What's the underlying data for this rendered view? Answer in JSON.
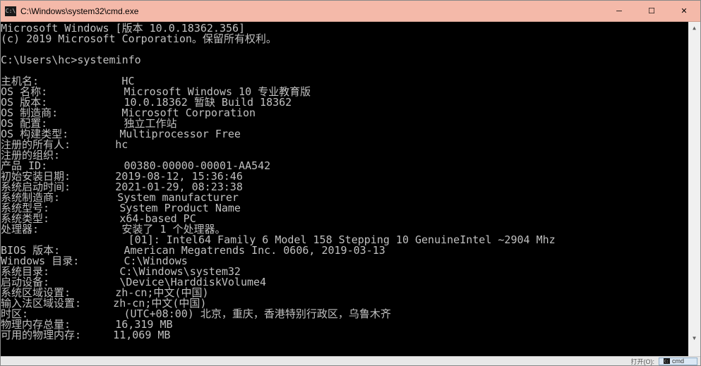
{
  "titlebar": {
    "icon_label": "C:\\",
    "title": "C:\\Windows\\system32\\cmd.exe",
    "minimize": "─",
    "maximize": "☐",
    "close": "✕"
  },
  "terminal": {
    "header1": "Microsoft Windows [版本 10.0.18362.356]",
    "header2": "(c) 2019 Microsoft Corporation。保留所有权利。",
    "prompt": "C:\\Users\\hc>",
    "command": "systeminfo",
    "rows": [
      {
        "label": "主机名:",
        "value": "HC"
      },
      {
        "label": "OS 名称:",
        "value": "Microsoft Windows 10 专业教育版"
      },
      {
        "label": "OS 版本:",
        "value": "10.0.18362 暂缺 Build 18362"
      },
      {
        "label": "OS 制造商:",
        "value": "Microsoft Corporation"
      },
      {
        "label": "OS 配置:",
        "value": "独立工作站"
      },
      {
        "label": "OS 构建类型:",
        "value": "Multiprocessor Free"
      },
      {
        "label": "注册的所有人:",
        "value": "hc"
      },
      {
        "label": "注册的组织:",
        "value": ""
      },
      {
        "label": "产品 ID:",
        "value": "00380-00000-00001-AA542"
      },
      {
        "label": "初始安装日期:",
        "value": "2019-08-12, 15:36:46"
      },
      {
        "label": "系统启动时间:",
        "value": "2021-01-29, 08:23:38"
      },
      {
        "label": "系统制造商:",
        "value": "System manufacturer"
      },
      {
        "label": "系统型号:",
        "value": "System Product Name"
      },
      {
        "label": "系统类型:",
        "value": "x64-based PC"
      },
      {
        "label": "处理器:",
        "value": "安装了 1 个处理器。"
      },
      {
        "label": "",
        "value": "[01]: Intel64 Family 6 Model 158 Stepping 10 GenuineIntel ~2904 Mhz"
      },
      {
        "label": "BIOS 版本:",
        "value": "American Megatrends Inc. 0606, 2019-03-13"
      },
      {
        "label": "Windows 目录:",
        "value": "C:\\Windows"
      },
      {
        "label": "系统目录:",
        "value": "C:\\Windows\\system32"
      },
      {
        "label": "启动设备:",
        "value": "\\Device\\HarddiskVolume4"
      },
      {
        "label": "系统区域设置:",
        "value": "zh-cn;中文(中国)"
      },
      {
        "label": "输入法区域设置:",
        "value": "zh-cn;中文(中国)"
      },
      {
        "label": "时区:",
        "value": "(UTC+08:00) 北京，重庆，香港特别行政区，乌鲁木齐"
      },
      {
        "label": "物理内存总量:",
        "value": "16,319 MB"
      },
      {
        "label": "可用的物理内存:",
        "value": "11,069 MB"
      }
    ]
  },
  "scrollbar": {
    "up": "▲",
    "down": "▼"
  },
  "taskbar": {
    "open_label": "打开(O):",
    "cmd_label": "cmd"
  }
}
